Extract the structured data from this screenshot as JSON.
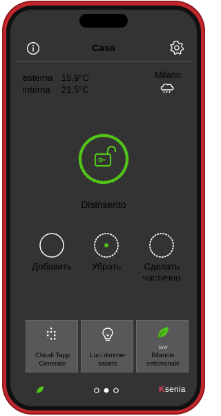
{
  "header": {
    "title": "Casa"
  },
  "weather": {
    "outdoor_label": "esterna",
    "outdoor_temp": "15.9°C",
    "indoor_label": "interna",
    "indoor_temp": "21.5°C",
    "city": "Milano",
    "condition_icon": "cloud-rain-icon"
  },
  "alarm": {
    "status": "Disinserito",
    "accent_color": "#52c41a"
  },
  "modes": [
    {
      "label": "Добавить"
    },
    {
      "label": "Убрать"
    },
    {
      "label": "Сделать частично"
    }
  ],
  "tiles": [
    {
      "label": "Chiudi Tapp Generale",
      "icon": "blinds-grid-icon"
    },
    {
      "label": "Luci dimmer salotto",
      "icon": "lightbulb-icon"
    },
    {
      "label": "Bilancio settimanale",
      "top_text": "5kW",
      "icon": "green-leaf-icon"
    }
  ],
  "footer": {
    "brand_first": "K",
    "brand_rest": "senia",
    "page_count": 3,
    "active_page": 2
  }
}
